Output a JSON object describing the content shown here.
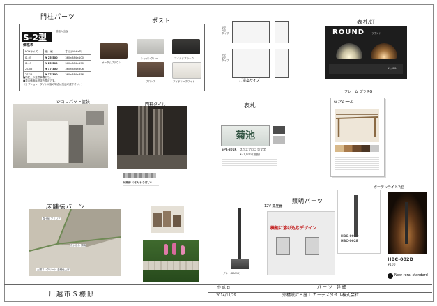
{
  "sections": {
    "gate_post": "門柱パーツ",
    "post": "ポスト",
    "nameplate_light": "表札灯",
    "jolypate": "ジョリパット塗装",
    "gate_tile": "門柱タイル",
    "nameplate": "表札",
    "frame": "フレーム プラスG",
    "floor": "床舗装パーツ",
    "lighting": "照明パーツ",
    "garden_light": "ガーデンライト2型"
  },
  "post_block": {
    "model": "S-2型",
    "model_note": "前面入出板",
    "price_title": "価格表",
    "table_header": [
      "BOXサイズ",
      "価　格",
      "寸 法(WxHxD)"
    ],
    "table_rows": [
      [
        "IS-05",
        "¥ 25,500",
        "360×384×100"
      ],
      [
        "IS-15",
        "¥ 25,500",
        "360×384×150"
      ],
      [
        "2S-05",
        "¥ 37,300",
        "360×384×306"
      ],
      [
        "2S-15",
        "¥ 37,300",
        "360×384×356"
      ]
    ],
    "notes": [
      "■防犯上の注意事項あり。",
      "■表示価格は税抜き表示です。",
      "（オプション、ダイヤル錠の場合は別途考慮下さい。）"
    ],
    "colors": [
      "オータムブラウン",
      "シャイングレー",
      "マイルドブラック",
      "ブロンズ",
      "アイボリーホワイト"
    ],
    "type_a": "1型\n2型\nタイプ",
    "type_b": "2型\n1型\nタイプ",
    "proposal": "ご提案サイズ"
  },
  "light_block": {
    "brand": "ROUND",
    "brand_sub": "ラウンド",
    "price": "¥1,000-"
  },
  "nameplate_block": {
    "plate_text": "菊池",
    "model": "SPL-301K",
    "desc": "スクエアロゴ 切文字",
    "price": "¥31,000-(税抜)"
  },
  "frame_block": {
    "title": "Gフレーム"
  },
  "floor_labels": {
    "a": "真土鋪 アドリア",
    "b": "洗い出し 舗装",
    "c": "土間コンクリート 金鏝仕上げ"
  },
  "lighting_block": {
    "transformer": "12V 変圧器",
    "catchphrase": "機能に溶け込むデザイン",
    "models": [
      "HBC-002D",
      "HBC-002B"
    ],
    "brand_code": "HBC-002D",
    "brand_price": "¥100",
    "new_std": "New reral standard",
    "color_label": "グレー(BSA15)"
  },
  "gate_tile_block": {
    "name": "千鳥形（せんろうはい）"
  },
  "footer": {
    "client": "川越市Ｓ様邸",
    "date_label": "作 成 日",
    "date": "2014/11/29",
    "title": "パーツ 詳細",
    "company": "外構設計・施工 ガーデスタイル株式会社"
  }
}
